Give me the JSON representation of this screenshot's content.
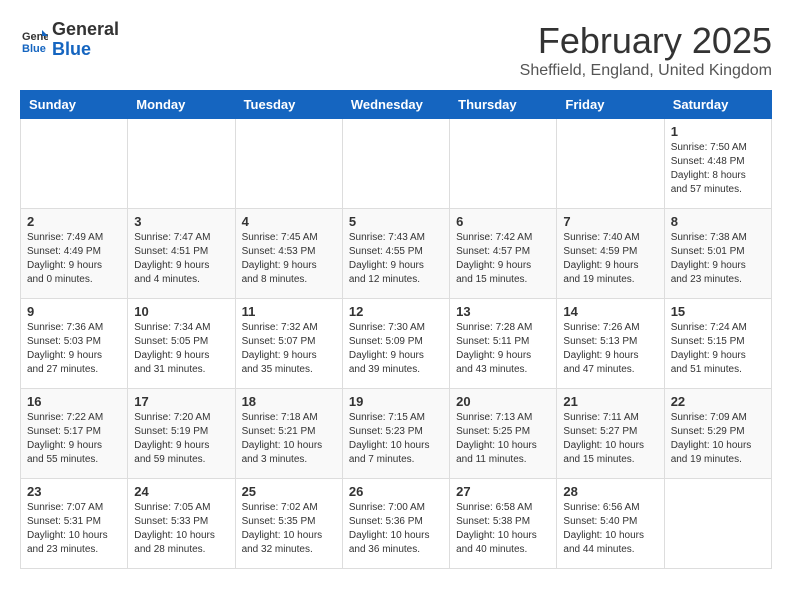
{
  "header": {
    "logo_general": "General",
    "logo_blue": "Blue",
    "month_title": "February 2025",
    "location": "Sheffield, England, United Kingdom"
  },
  "days_of_week": [
    "Sunday",
    "Monday",
    "Tuesday",
    "Wednesday",
    "Thursday",
    "Friday",
    "Saturday"
  ],
  "weeks": [
    [
      {
        "day": "",
        "info": ""
      },
      {
        "day": "",
        "info": ""
      },
      {
        "day": "",
        "info": ""
      },
      {
        "day": "",
        "info": ""
      },
      {
        "day": "",
        "info": ""
      },
      {
        "day": "",
        "info": ""
      },
      {
        "day": "1",
        "info": "Sunrise: 7:50 AM\nSunset: 4:48 PM\nDaylight: 8 hours\nand 57 minutes."
      }
    ],
    [
      {
        "day": "2",
        "info": "Sunrise: 7:49 AM\nSunset: 4:49 PM\nDaylight: 9 hours\nand 0 minutes."
      },
      {
        "day": "3",
        "info": "Sunrise: 7:47 AM\nSunset: 4:51 PM\nDaylight: 9 hours\nand 4 minutes."
      },
      {
        "day": "4",
        "info": "Sunrise: 7:45 AM\nSunset: 4:53 PM\nDaylight: 9 hours\nand 8 minutes."
      },
      {
        "day": "5",
        "info": "Sunrise: 7:43 AM\nSunset: 4:55 PM\nDaylight: 9 hours\nand 12 minutes."
      },
      {
        "day": "6",
        "info": "Sunrise: 7:42 AM\nSunset: 4:57 PM\nDaylight: 9 hours\nand 15 minutes."
      },
      {
        "day": "7",
        "info": "Sunrise: 7:40 AM\nSunset: 4:59 PM\nDaylight: 9 hours\nand 19 minutes."
      },
      {
        "day": "8",
        "info": "Sunrise: 7:38 AM\nSunset: 5:01 PM\nDaylight: 9 hours\nand 23 minutes."
      }
    ],
    [
      {
        "day": "9",
        "info": "Sunrise: 7:36 AM\nSunset: 5:03 PM\nDaylight: 9 hours\nand 27 minutes."
      },
      {
        "day": "10",
        "info": "Sunrise: 7:34 AM\nSunset: 5:05 PM\nDaylight: 9 hours\nand 31 minutes."
      },
      {
        "day": "11",
        "info": "Sunrise: 7:32 AM\nSunset: 5:07 PM\nDaylight: 9 hours\nand 35 minutes."
      },
      {
        "day": "12",
        "info": "Sunrise: 7:30 AM\nSunset: 5:09 PM\nDaylight: 9 hours\nand 39 minutes."
      },
      {
        "day": "13",
        "info": "Sunrise: 7:28 AM\nSunset: 5:11 PM\nDaylight: 9 hours\nand 43 minutes."
      },
      {
        "day": "14",
        "info": "Sunrise: 7:26 AM\nSunset: 5:13 PM\nDaylight: 9 hours\nand 47 minutes."
      },
      {
        "day": "15",
        "info": "Sunrise: 7:24 AM\nSunset: 5:15 PM\nDaylight: 9 hours\nand 51 minutes."
      }
    ],
    [
      {
        "day": "16",
        "info": "Sunrise: 7:22 AM\nSunset: 5:17 PM\nDaylight: 9 hours\nand 55 minutes."
      },
      {
        "day": "17",
        "info": "Sunrise: 7:20 AM\nSunset: 5:19 PM\nDaylight: 9 hours\nand 59 minutes."
      },
      {
        "day": "18",
        "info": "Sunrise: 7:18 AM\nSunset: 5:21 PM\nDaylight: 10 hours\nand 3 minutes."
      },
      {
        "day": "19",
        "info": "Sunrise: 7:15 AM\nSunset: 5:23 PM\nDaylight: 10 hours\nand 7 minutes."
      },
      {
        "day": "20",
        "info": "Sunrise: 7:13 AM\nSunset: 5:25 PM\nDaylight: 10 hours\nand 11 minutes."
      },
      {
        "day": "21",
        "info": "Sunrise: 7:11 AM\nSunset: 5:27 PM\nDaylight: 10 hours\nand 15 minutes."
      },
      {
        "day": "22",
        "info": "Sunrise: 7:09 AM\nSunset: 5:29 PM\nDaylight: 10 hours\nand 19 minutes."
      }
    ],
    [
      {
        "day": "23",
        "info": "Sunrise: 7:07 AM\nSunset: 5:31 PM\nDaylight: 10 hours\nand 23 minutes."
      },
      {
        "day": "24",
        "info": "Sunrise: 7:05 AM\nSunset: 5:33 PM\nDaylight: 10 hours\nand 28 minutes."
      },
      {
        "day": "25",
        "info": "Sunrise: 7:02 AM\nSunset: 5:35 PM\nDaylight: 10 hours\nand 32 minutes."
      },
      {
        "day": "26",
        "info": "Sunrise: 7:00 AM\nSunset: 5:36 PM\nDaylight: 10 hours\nand 36 minutes."
      },
      {
        "day": "27",
        "info": "Sunrise: 6:58 AM\nSunset: 5:38 PM\nDaylight: 10 hours\nand 40 minutes."
      },
      {
        "day": "28",
        "info": "Sunrise: 6:56 AM\nSunset: 5:40 PM\nDaylight: 10 hours\nand 44 minutes."
      },
      {
        "day": "",
        "info": ""
      }
    ]
  ]
}
